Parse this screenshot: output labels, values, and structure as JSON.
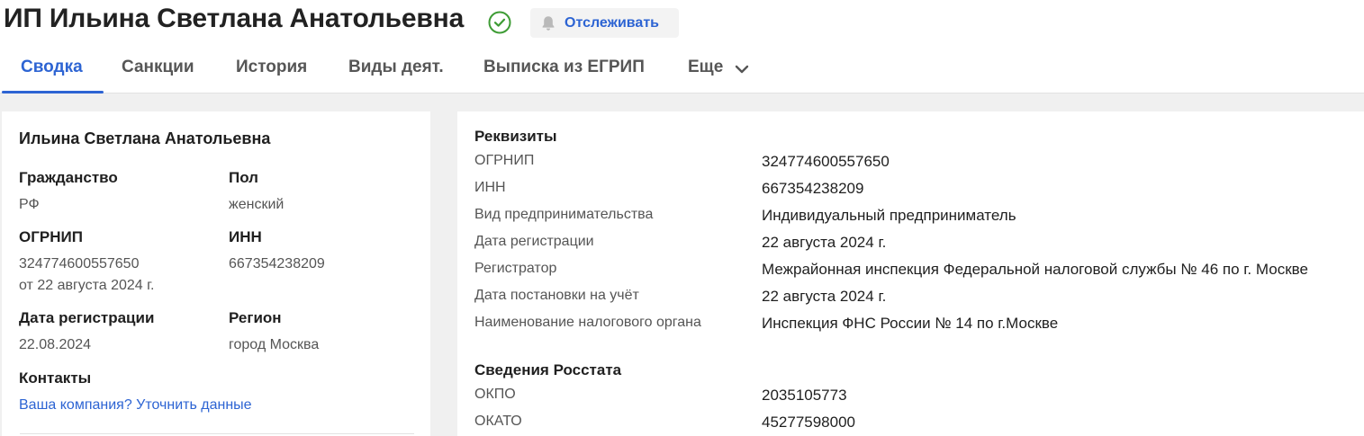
{
  "header": {
    "title": "ИП Ильина Светлана Анатольевна",
    "watch_label": "Отслеживать",
    "status_icon": "check-circle-icon",
    "watch_icon": "bell-icon"
  },
  "tabs": [
    {
      "label": "Сводка",
      "active": true
    },
    {
      "label": "Санкции"
    },
    {
      "label": "История"
    },
    {
      "label": "Виды деят."
    },
    {
      "label": "Выписка из ЕГРИП"
    },
    {
      "label": "Еще"
    }
  ],
  "summary": {
    "name": "Ильина Светлана Анатольевна",
    "citizenship": {
      "label": "Гражданство",
      "value": "РФ"
    },
    "gender": {
      "label": "Пол",
      "value": "женский"
    },
    "ogrnip": {
      "label": "ОГРНИП",
      "value": "324774600557650",
      "date": "от 22 августа 2024 г."
    },
    "inn": {
      "label": "ИНН",
      "value": "667354238209"
    },
    "reg_date": {
      "label": "Дата регистрации",
      "value": "22.08.2024"
    },
    "region": {
      "label": "Регион",
      "value": "город Москва"
    },
    "contacts": {
      "label": "Контакты",
      "link": "Ваша компания? Уточнить данные"
    }
  },
  "requisites": {
    "title": "Реквизиты",
    "rows": [
      {
        "key": "ОГРНИП",
        "value": "324774600557650"
      },
      {
        "key": "ИНН",
        "value": "667354238209"
      },
      {
        "key": "Вид предпринимательства",
        "value": "Индивидуальный предприниматель"
      },
      {
        "key": "Дата регистрации",
        "value": "22 августа 2024 г."
      },
      {
        "key": "Регистратор",
        "value": "Межрайонная инспекция Федеральной налоговой службы № 46 по г. Москве"
      },
      {
        "key": "Дата постановки на учёт",
        "value": "22 августа 2024 г."
      },
      {
        "key": "Наименование налогового органа",
        "value": "Инспекция ФНС России № 14 по г.Москве"
      }
    ]
  },
  "rosstat": {
    "title": "Сведения Росстата",
    "rows": [
      {
        "key": "ОКПО",
        "value": "2035105773"
      },
      {
        "key": "ОКАТО",
        "value": "45277598000"
      }
    ]
  },
  "colors": {
    "accent": "#2d64d3",
    "success": "#3e9c35"
  }
}
